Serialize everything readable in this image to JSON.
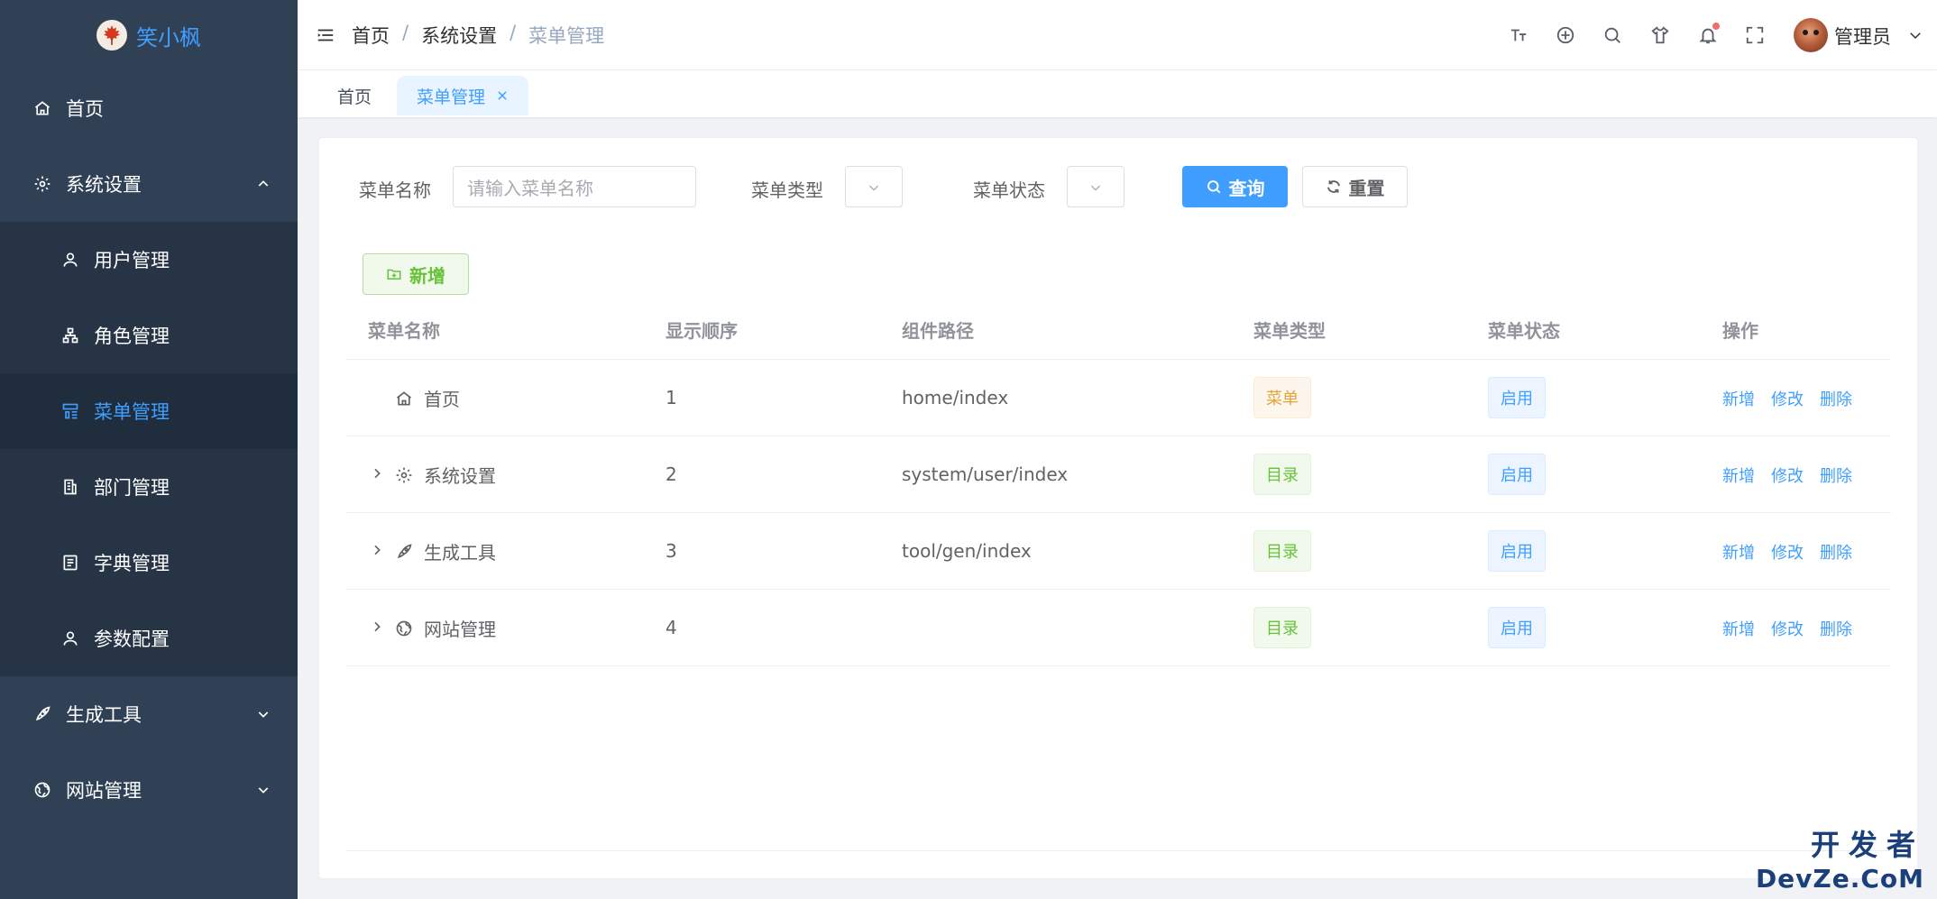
{
  "app": {
    "logo_text": "笑小枫"
  },
  "sidebar": {
    "items": [
      {
        "label": "首页"
      },
      {
        "label": "系统设置"
      },
      {
        "label": "用户管理"
      },
      {
        "label": "角色管理"
      },
      {
        "label": "菜单管理"
      },
      {
        "label": "部门管理"
      },
      {
        "label": "字典管理"
      },
      {
        "label": "参数配置"
      },
      {
        "label": "生成工具"
      },
      {
        "label": "网站管理"
      }
    ],
    "active": "菜单管理",
    "expanded": "系统设置"
  },
  "header": {
    "breadcrumb": [
      "首页",
      "系统设置",
      "菜单管理"
    ],
    "separator": "/",
    "username": "管理员"
  },
  "tags": [
    {
      "label": "首页"
    },
    {
      "label": "菜单管理"
    }
  ],
  "search": {
    "name_label": "菜单名称",
    "name_placeholder": "请输入菜单名称",
    "type_label": "菜单类型",
    "status_label": "菜单状态",
    "query_label": "查询",
    "reset_label": "重置"
  },
  "toolbar": {
    "add_label": "新增"
  },
  "table": {
    "columns": [
      "菜单名称",
      "显示顺序",
      "组件路径",
      "菜单类型",
      "菜单状态",
      "操作"
    ],
    "rows": [
      {
        "name": "首页",
        "icon": "home-icon",
        "order": "1",
        "path": "home/index",
        "type": "菜单",
        "status": "启用",
        "expandable": false
      },
      {
        "name": "系统设置",
        "icon": "gear-icon",
        "order": "2",
        "path": "system/user/index",
        "type": "目录",
        "status": "启用",
        "expandable": true
      },
      {
        "name": "生成工具",
        "icon": "rocket-icon",
        "order": "3",
        "path": "tool/gen/index",
        "type": "目录",
        "status": "启用",
        "expandable": true
      },
      {
        "name": "网站管理",
        "icon": "globe-icon",
        "order": "4",
        "path": "",
        "type": "目录",
        "status": "启用",
        "expandable": true
      }
    ],
    "actions": {
      "add": "新增",
      "edit": "修改",
      "delete": "删除"
    }
  },
  "watermark": {
    "line1": "开发者",
    "line2": "DevZe.CoM"
  },
  "colors": {
    "sidebar_bg": "#304156",
    "accent": "#409eff",
    "success": "#67c23a",
    "warning": "#e6a23c",
    "danger": "#f56c6c"
  }
}
